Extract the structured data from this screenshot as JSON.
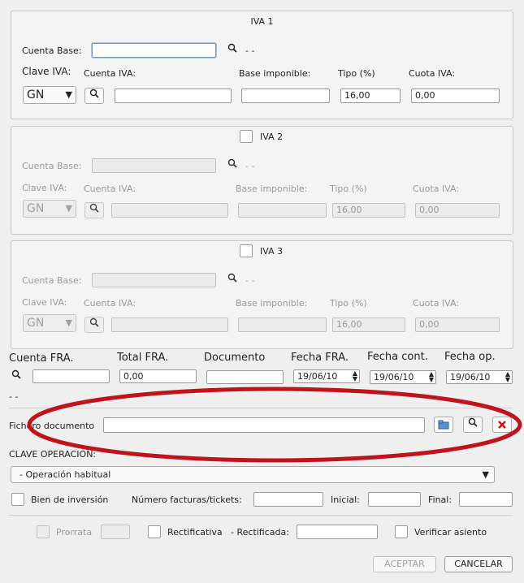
{
  "iva1": {
    "title": "IVA 1",
    "cuenta_base_label": "Cuenta Base:",
    "cuenta_base_value": "",
    "cuenta_base_desc": "- -",
    "clave_label": "Clave IVA:",
    "clave_value": "GN",
    "cuenta_iva_label": "Cuenta IVA:",
    "base_label": "Base imponible:",
    "tipo_label": "Tipo (%)",
    "cuota_label": "Cuota IVA:",
    "tipo_value": "16,00",
    "cuota_value": "0,00"
  },
  "iva2": {
    "title": "IVA 2",
    "cuenta_base_label": "Cuenta Base:",
    "cuenta_base_desc": "- -",
    "clave_label": "Clave IVA:",
    "clave_value": "GN",
    "cuenta_iva_label": "Cuenta IVA:",
    "base_label": "Base imponible:",
    "tipo_label": "Tipo (%)",
    "cuota_label": "Cuota IVA:",
    "tipo_value": "16,00",
    "cuota_value": "0,00"
  },
  "iva3": {
    "title": "IVA 3",
    "cuenta_base_label": "Cuenta Base:",
    "cuenta_base_desc": "- -",
    "clave_label": "Clave IVA:",
    "clave_value": "GN",
    "cuenta_iva_label": "Cuenta IVA:",
    "base_label": "Base imponible:",
    "tipo_label": "Tipo (%)",
    "cuota_label": "Cuota IVA:",
    "tipo_value": "16,00",
    "cuota_value": "0,00"
  },
  "factura": {
    "cuenta_label": "Cuenta FRA.",
    "total_label": "Total FRA.",
    "documento_label": "Documento",
    "fecha_fra_label": "Fecha FRA.",
    "fecha_cont_label": "Fecha cont.",
    "fecha_op_label": "Fecha op.",
    "total_value": "0,00",
    "fecha_fra_value": "19/06/10",
    "fecha_cont_value": "19/06/10",
    "fecha_op_value": "19/06/10",
    "cuenta_desc": "- -"
  },
  "fichero": {
    "label": "Fichero documento"
  },
  "operacion": {
    "label": "CLAVE OPERACION:",
    "value": "- Operación habitual"
  },
  "extra": {
    "bien_label": "Bien de inversión",
    "num_facturas_label": "Número facturas/tickets:",
    "inicial_label": "Inicial:",
    "final_label": "Final:",
    "prorrata_label": "Prorrata",
    "rectificativa_label": "Rectificativa",
    "rectificada_label": "- Rectificada:",
    "verificar_label": "Verificar asiento"
  },
  "buttons": {
    "aceptar": "ACEPTAR",
    "cancelar": "CANCELAR"
  },
  "colors": {
    "annotation": "#c0141c"
  }
}
